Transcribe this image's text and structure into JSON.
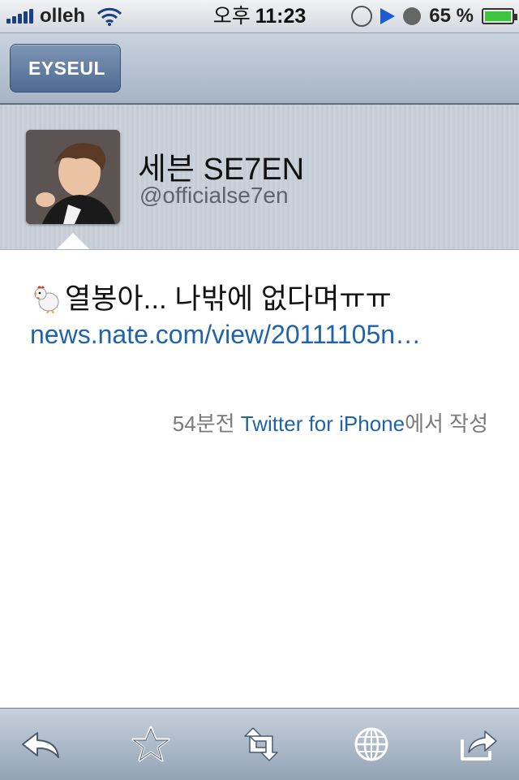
{
  "status_bar": {
    "carrier": "olleh",
    "ampm": "오후",
    "time": "11:23",
    "battery_percent": "65 %",
    "signal_icon": "signal-bars-icon",
    "wifi_icon": "wifi-icon",
    "rotation_lock_icon": "rotation-lock-icon",
    "play_icon": "play-icon",
    "alarm_icon": "alarm-icon",
    "battery_icon": "battery-charging-icon"
  },
  "nav": {
    "back_label": "EYSEUL"
  },
  "profile": {
    "name": "세븐 SE7EN",
    "handle": "@officialse7en"
  },
  "tweet": {
    "text": "열봉아... 나밖에 없다며ㅠㅠ",
    "emoji_icon": "chicken-icon",
    "link": "news.nate.com/view/20111105n…",
    "time_ago": "54분전",
    "via": "Twitter for iPhone",
    "suffix": "에서 작성"
  },
  "toolbar": {
    "items": [
      "reply-icon",
      "star-icon",
      "retweet-icon",
      "globe-icon",
      "share-icon"
    ]
  },
  "colors": {
    "link": "#1f63ad",
    "nav_back": "#4e6b93"
  }
}
